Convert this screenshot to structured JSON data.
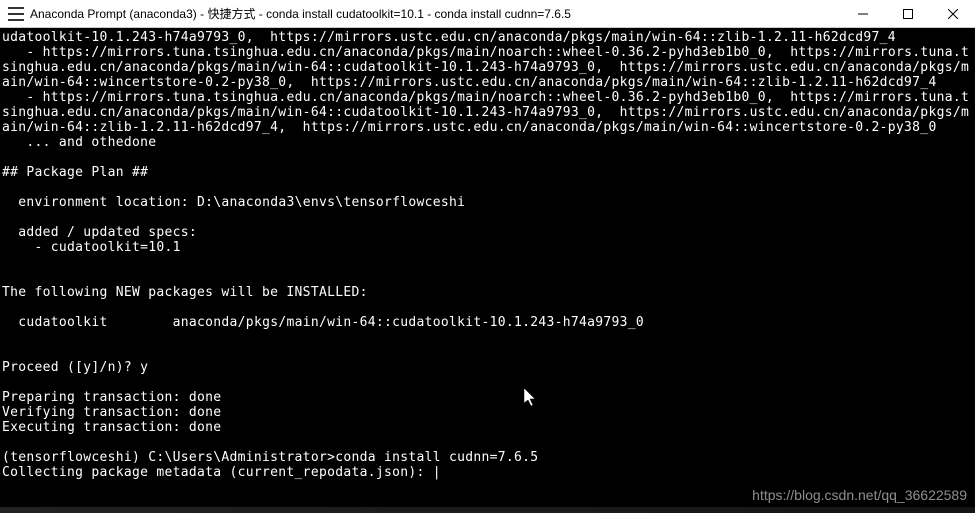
{
  "titlebar": {
    "title": "Anaconda Prompt (anaconda3) - 快捷方式 - conda  install cudatoolkit=10.1 - conda  install cudnn=7.6.5"
  },
  "terminal": {
    "lines": [
      "udatoolkit-10.1.243-h74a9793_0,  https://mirrors.ustc.edu.cn/anaconda/pkgs/main/win-64::zlib-1.2.11-h62dcd97_4",
      "   - https://mirrors.tuna.tsinghua.edu.cn/anaconda/pkgs/main/noarch::wheel-0.36.2-pyhd3eb1b0_0,  https://mirrors.tuna.tsinghua.edu.cn/anaconda/pkgs/main/win-64::cudatoolkit-10.1.243-h74a9793_0,  https://mirrors.ustc.edu.cn/anaconda/pkgs/main/win-64::wincertstore-0.2-py38_0,  https://mirrors.ustc.edu.cn/anaconda/pkgs/main/win-64::zlib-1.2.11-h62dcd97_4",
      "   - https://mirrors.tuna.tsinghua.edu.cn/anaconda/pkgs/main/noarch::wheel-0.36.2-pyhd3eb1b0_0,  https://mirrors.tuna.tsinghua.edu.cn/anaconda/pkgs/main/win-64::cudatoolkit-10.1.243-h74a9793_0,  https://mirrors.ustc.edu.cn/anaconda/pkgs/main/win-64::zlib-1.2.11-h62dcd97_4,  https://mirrors.ustc.edu.cn/anaconda/pkgs/main/win-64::wincertstore-0.2-py38_0",
      "   ... and othedone",
      "",
      "## Package Plan ##",
      "",
      "  environment location: D:\\anaconda3\\envs\\tensorflowceshi",
      "",
      "  added / updated specs:",
      "    - cudatoolkit=10.1",
      "",
      "",
      "The following NEW packages will be INSTALLED:",
      "",
      "  cudatoolkit        anaconda/pkgs/main/win-64::cudatoolkit-10.1.243-h74a9793_0",
      "",
      "",
      "Proceed ([y]/n)? y",
      "",
      "Preparing transaction: done",
      "Verifying transaction: done",
      "Executing transaction: done",
      "",
      "(tensorflowceshi) C:\\Users\\Administrator>conda install cudnn=7.6.5",
      "Collecting package metadata (current_repodata.json): |"
    ]
  },
  "watermark": "https://blog.csdn.net/qq_36622589"
}
